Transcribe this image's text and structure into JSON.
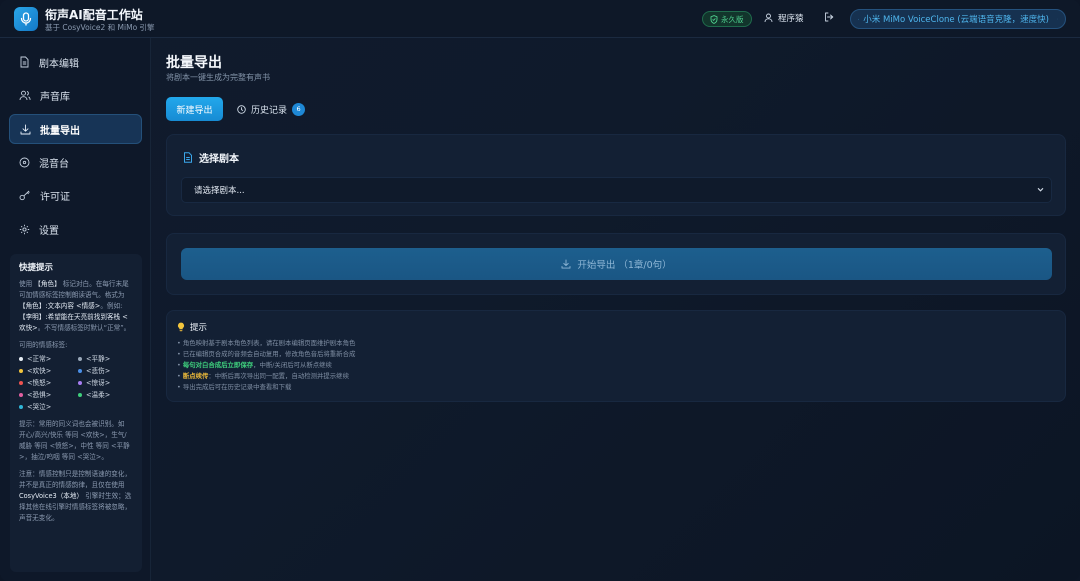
{
  "header": {
    "title": "衔声AI配音工作站",
    "subtitle": "基于 CosyVoice2 和 MiMo 引擎",
    "license_badge": "永久版",
    "username": "程序猿",
    "engine": "小米 MiMo VoiceClone (云端语音克隆，速度快)"
  },
  "sidebar": {
    "items": [
      {
        "label": "剧本编辑",
        "icon": "document-icon"
      },
      {
        "label": "声音库",
        "icon": "users-icon"
      },
      {
        "label": "批量导出",
        "icon": "download-icon"
      },
      {
        "label": "混音台",
        "icon": "disc-icon"
      },
      {
        "label": "许可证",
        "icon": "key-icon"
      },
      {
        "label": "设置",
        "icon": "gear-icon"
      }
    ],
    "active_index": 2
  },
  "quick_tips": {
    "title": "快捷提示",
    "intro_1": "使用",
    "intro_role": "【角色】",
    "intro_2": "标记对白。在每行末尾可加情感标签控制朗读语气。格式为",
    "format": "【角色】:文本内容 <情感>",
    "intro_3": "。例如:",
    "example": "【李明】:希望能在天亮前找到客栈 <欢快>",
    "intro_4": "。不写情感标签时默认“正常”。",
    "emotions_label": "可用的情感标签:",
    "emotions": [
      {
        "label": "<正常>",
        "color": "#e6edf5"
      },
      {
        "label": "<平静>",
        "color": "#9aa8b9"
      },
      {
        "label": "<欢快>",
        "color": "#f2c53d"
      },
      {
        "label": "<悲伤>",
        "color": "#4a8fe7"
      },
      {
        "label": "<愤怒>",
        "color": "#ef5350"
      },
      {
        "label": "<惊讶>",
        "color": "#a77df2"
      },
      {
        "label": "<恐惧>",
        "color": "#e05fa0"
      },
      {
        "label": "<温柔>",
        "color": "#3ecf7c"
      },
      {
        "label": "<哭泣>",
        "color": "#2fb5d6"
      }
    ],
    "note_synonyms": "提示：常用的同义词也会被识别。如 开心/高兴/快乐 等同 <欢快>，生气/威胁 等同 <愤怒>，中性 等同 <平静>，抽泣/呜咽 等同 <哭泣>。",
    "note_engine_1": "注意：情感控制只是控制语速的变化，并不是真正的情感韵律，且仅在使用",
    "note_engine_hl": "CosyVoice3（本地）",
    "note_engine_2": "引擎时生效；选择其他在线引擎时情感标签将被忽略，声音无变化。"
  },
  "main": {
    "title": "批量导出",
    "subtitle": "将剧本一键生成为完整有声书",
    "tab_new": "新建导出",
    "tab_history": "历史记录",
    "history_count": "6",
    "select_card_title": "选择剧本",
    "select_placeholder": "请选择剧本...",
    "export_button": "开始导出 （1章/0句）",
    "tips_title": "提示",
    "tips": [
      {
        "pre": "",
        "hl": "",
        "post": "角色映射基于剧本角色列表，请在剧本编辑页面维护剧本角色"
      },
      {
        "pre": "",
        "hl": "",
        "post": "已在编辑页合成的音频会自动复用，修改角色音后将重新合成"
      },
      {
        "pre": "",
        "hl": "每句对白合成后立即保存",
        "post": "，中断/关闭后可从断点继续"
      },
      {
        "pre": "",
        "hl": "断点续传",
        "post": "：中断后再次导出同一配置，自动检测并提示继续"
      },
      {
        "pre": "",
        "hl": "",
        "post": "导出完成后可在历史记录中查看和下载"
      }
    ]
  },
  "colors": {
    "accent": "#1e9be2",
    "success": "#3fcf7d",
    "warning": "#e8b73a",
    "background": "#0f1a2b"
  }
}
